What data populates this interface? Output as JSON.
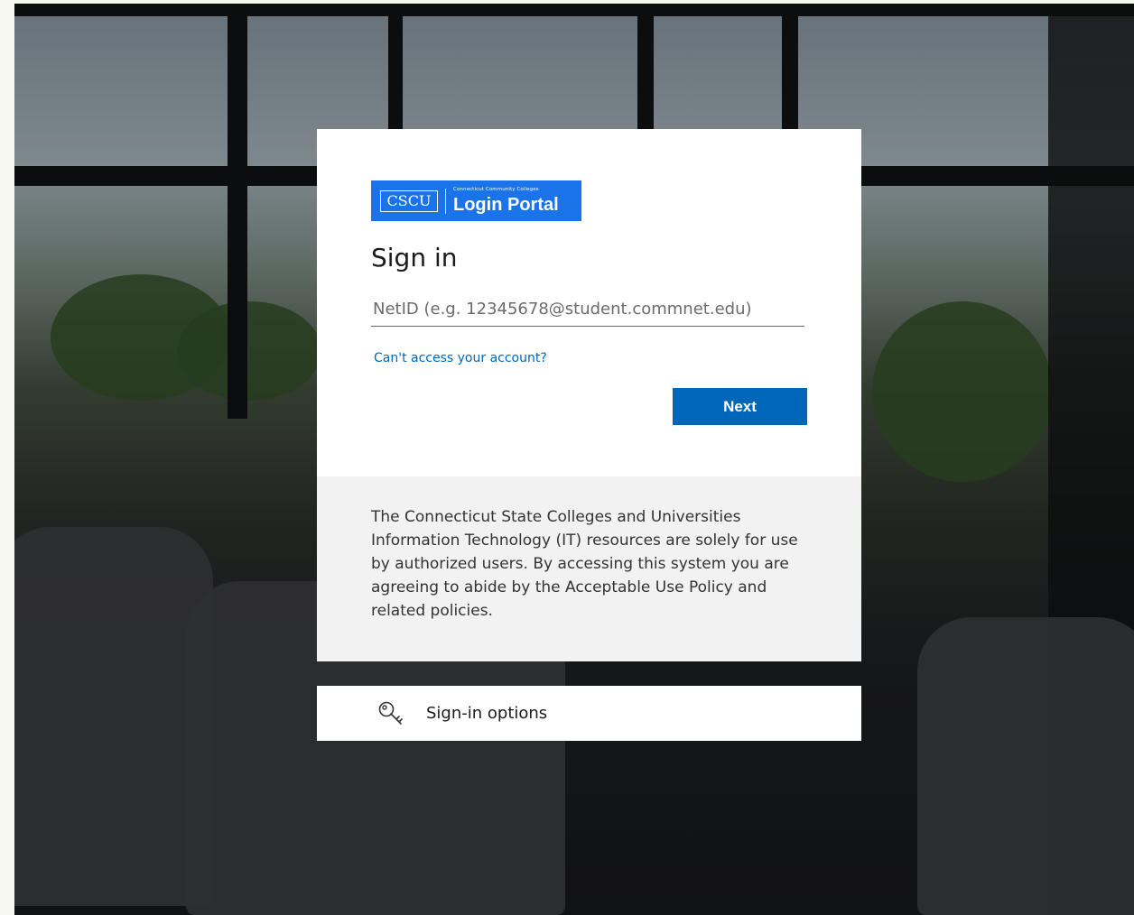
{
  "logo": {
    "abbr": "CSCU",
    "subtitle": "Connecticut Community Colleges",
    "name": "Login Portal",
    "color": "#1a73e8"
  },
  "signin": {
    "title": "Sign in",
    "email_placeholder": "NetID (e.g. 12345678@student.commnet.edu)",
    "email_value": "",
    "cant_access_link": "Can't access your account?",
    "next_button": "Next",
    "accent_color": "#0067b8"
  },
  "notice": {
    "text": "The Connecticut State Colleges and Universities Information Technology (IT) resources are solely for use by authorized users. By accessing this system you are agreeing to abide by the Acceptable Use Policy and related policies."
  },
  "signin_options": {
    "label": "Sign-in options",
    "icon": "key-icon"
  }
}
